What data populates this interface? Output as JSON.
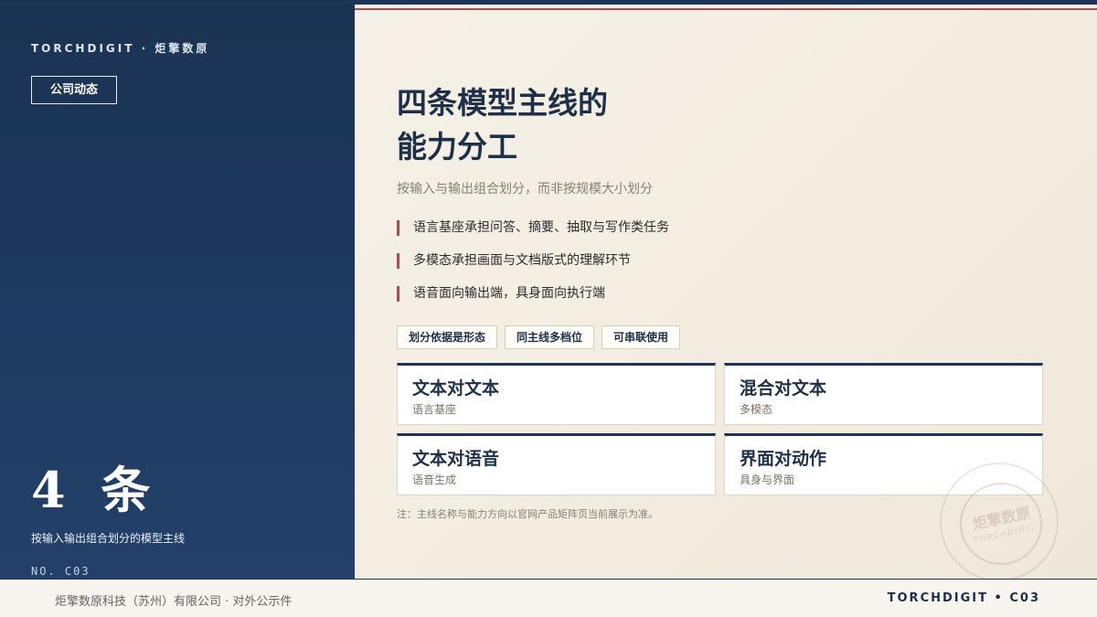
{
  "brand": {
    "top_label": "TORCHDIGIT · 炬擎数原"
  },
  "left_panel": {
    "tag": "公司动态",
    "count": "4 条",
    "count_desc": "按输入输出组合划分的模型主线",
    "doc_no": "NO. C03"
  },
  "main": {
    "title_line1": "四条模型主线的",
    "title_line2": "能力分工",
    "subtitle": "按输入与输出组合划分，而非按规模大小划分",
    "points": [
      "语言基座承担问答、摘要、抽取与写作类任务",
      "多模态承担画面与文档版式的理解环节",
      "语音面向输出端，具身面向执行端"
    ],
    "chips": [
      "划分依据是形态",
      "同主线多档位",
      "可串联使用"
    ],
    "cards": [
      {
        "title": "文本对文本",
        "sub": "语言基座"
      },
      {
        "title": "混合对文本",
        "sub": "多模态"
      },
      {
        "title": "文本对语音",
        "sub": "语音生成"
      },
      {
        "title": "界面对动作",
        "sub": "具身与界面"
      }
    ],
    "note": "注：主线名称与能力方向以官网产品矩阵页当前展示为准。"
  },
  "seal": {
    "cn": "炬擎数原",
    "en": "TORCHDIGIT"
  },
  "footer": {
    "left": "炬擎数原科技（苏州）有限公司 · 对外公示件",
    "right": "TORCHDIGIT • C03"
  },
  "colors": {
    "navy": "#1e3556",
    "accent_red": "#a3504d",
    "paper": "#f4efe6"
  }
}
